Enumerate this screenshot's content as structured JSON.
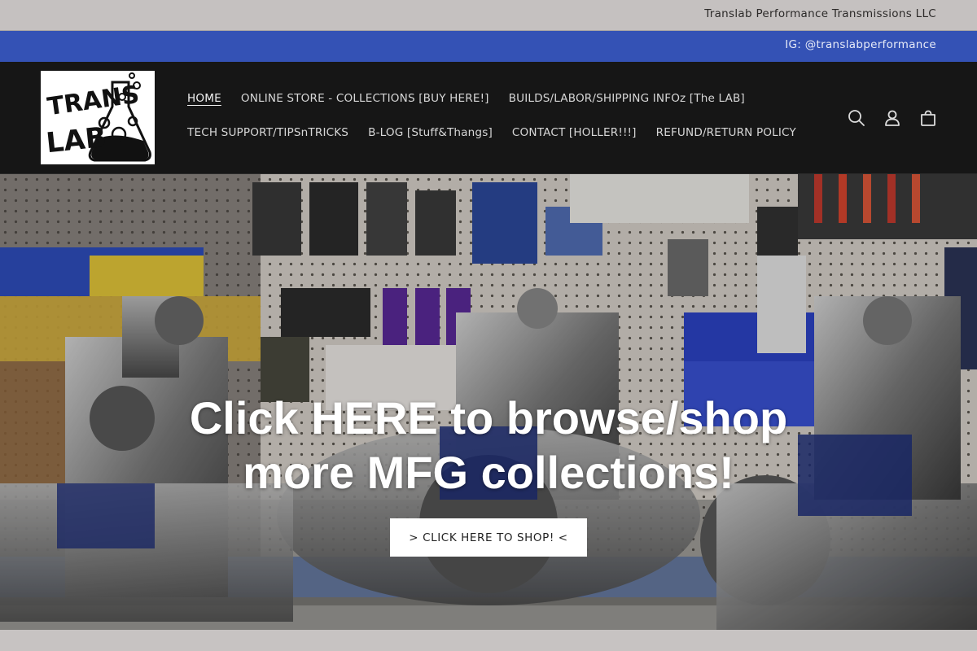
{
  "announcement": {
    "company": "Translab Performance Transmissions LLC"
  },
  "social_bar": {
    "instagram": "IG: @translabperformance"
  },
  "header": {
    "logo": {
      "text_top": "TRANS",
      "text_bottom": "LAB",
      "alt": "Translab logo"
    },
    "nav": {
      "row1": [
        {
          "label": "HOME",
          "active": true
        },
        {
          "label": "ONLINE STORE - COLLECTIONS [BUY HERE!]"
        },
        {
          "label": "BUILDS/LABOR/SHIPPING INFOz [The LAB]"
        }
      ],
      "row2": [
        {
          "label": "TECH SUPPORT/TIPSnTRICKS"
        },
        {
          "label": "B-LOG [Stuff&Thangs]"
        },
        {
          "label": "CONTACT [HOLLER!!!]"
        },
        {
          "label": "REFUND/RETURN POLICY"
        }
      ]
    },
    "icons": [
      "search-icon",
      "account-icon",
      "cart-icon"
    ]
  },
  "hero": {
    "heading": "Click HERE to browse/shop more MFG collections!",
    "button_label": "> CLICK HERE TO SHOP! <"
  },
  "colors": {
    "announcement_bg": "#c5c1c0",
    "social_bar_bg": "#3452b5",
    "header_bg": "#161616",
    "button_bg": "#ffffff"
  }
}
